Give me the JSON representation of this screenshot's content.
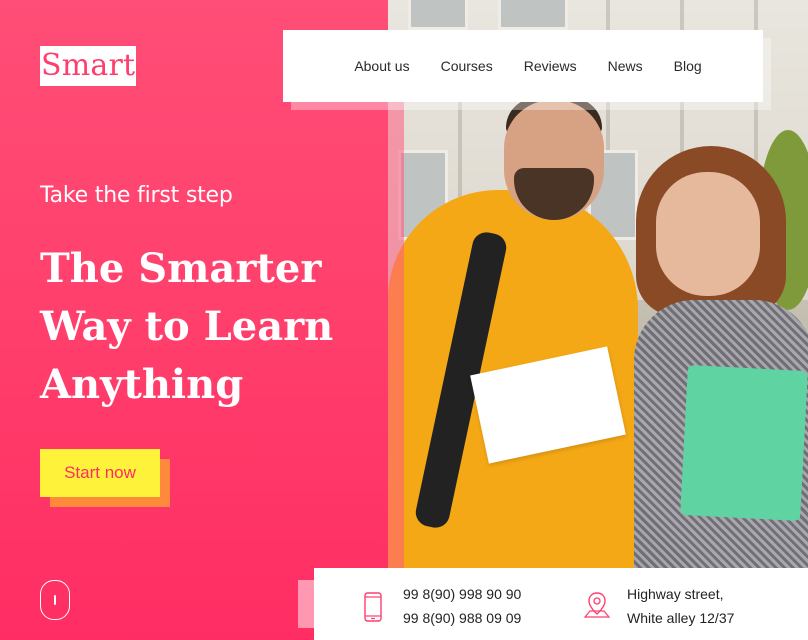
{
  "logo": {
    "text": "Smart"
  },
  "nav": {
    "items": [
      {
        "label": "About us"
      },
      {
        "label": "Courses"
      },
      {
        "label": "Reviews"
      },
      {
        "label": "News"
      },
      {
        "label": "Blog"
      }
    ]
  },
  "hero": {
    "tagline": "Take the first step",
    "headline": [
      "The Smarter",
      "Way to Learn",
      "Anything"
    ],
    "cta_label": "Start now"
  },
  "contact": {
    "phone_1": "99 8(90) 998 90 90",
    "phone_2": "99 8(90) 988 09 09",
    "address_line_1": "Highway street,",
    "address_line_2": "White alley 12/37"
  },
  "colors": {
    "brand_pink": "#ff3d6e",
    "cta_yellow": "#fff23b",
    "cta_shadow_orange": "#ff8a3c"
  },
  "icons": [
    "phone-icon",
    "map-pin-icon",
    "mouse-scroll-icon"
  ]
}
